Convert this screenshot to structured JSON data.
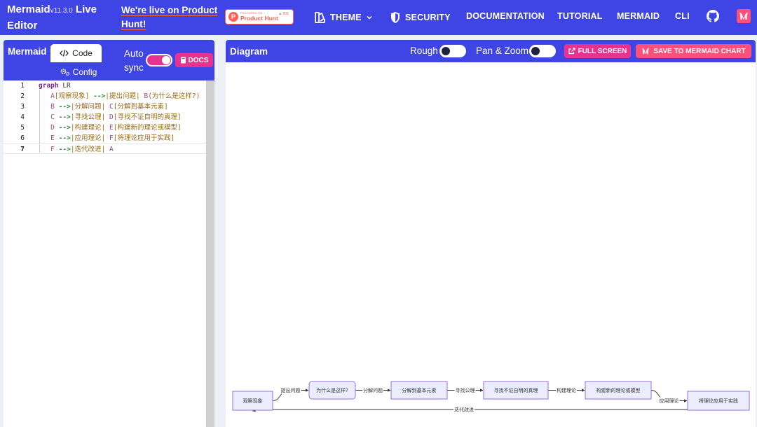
{
  "brand": {
    "name": "Mermaid",
    "version": "v11.3.0",
    "suffix": "Live Editor"
  },
  "promo": {
    "link_line1": "We're live on Product",
    "link_line2": "Hunt!",
    "badge_small": "FEATURED ON",
    "badge_text": "Product Hunt",
    "badge_count": "▲ 831"
  },
  "nav": {
    "theme": "THEME",
    "security": "SECURITY",
    "documentation": "DOCUMENTATION",
    "tutorial": "TUTORIAL",
    "mermaid": "MERMAID",
    "cli": "CLI"
  },
  "editor": {
    "title": "Mermaid",
    "tabs": {
      "code": "Code",
      "config": "Config"
    },
    "auto_sync_line1": "Auto",
    "auto_sync_line2": "sync",
    "auto_sync_on": true,
    "docs_label": "DOCS",
    "active_line": 7,
    "lines": [
      {
        "num": "1",
        "parts": [
          {
            "t": "kw",
            "v": "graph"
          },
          {
            "t": "pl",
            "v": " LR"
          }
        ]
      },
      {
        "num": "2",
        "parts": [
          {
            "t": "pl",
            "v": "   "
          },
          {
            "t": "nd",
            "v": "A"
          },
          {
            "t": "lb",
            "v": "[观察现象]"
          },
          {
            "t": "pl",
            "v": " "
          },
          {
            "t": "ar",
            "v": "-->"
          },
          {
            "t": "lb",
            "v": "|提出问题|"
          },
          {
            "t": "pl",
            "v": " "
          },
          {
            "t": "nd",
            "v": "B"
          },
          {
            "t": "lb",
            "v": "(为什么是这样?)"
          }
        ]
      },
      {
        "num": "3",
        "parts": [
          {
            "t": "pl",
            "v": "   "
          },
          {
            "t": "nd",
            "v": "B"
          },
          {
            "t": "pl",
            "v": " "
          },
          {
            "t": "ar",
            "v": "-->"
          },
          {
            "t": "lb",
            "v": "|分解问题|"
          },
          {
            "t": "pl",
            "v": " "
          },
          {
            "t": "nd",
            "v": "C"
          },
          {
            "t": "lb",
            "v": "[分解到基本元素]"
          }
        ]
      },
      {
        "num": "4",
        "parts": [
          {
            "t": "pl",
            "v": "   "
          },
          {
            "t": "nd",
            "v": "C"
          },
          {
            "t": "pl",
            "v": " "
          },
          {
            "t": "ar",
            "v": "-->"
          },
          {
            "t": "lb",
            "v": "|寻找公理|"
          },
          {
            "t": "pl",
            "v": " "
          },
          {
            "t": "nd",
            "v": "D"
          },
          {
            "t": "lb",
            "v": "[寻找不证自明的真理]"
          }
        ]
      },
      {
        "num": "5",
        "parts": [
          {
            "t": "pl",
            "v": "   "
          },
          {
            "t": "nd",
            "v": "D"
          },
          {
            "t": "pl",
            "v": " "
          },
          {
            "t": "ar",
            "v": "-->"
          },
          {
            "t": "lb",
            "v": "|构建理论|"
          },
          {
            "t": "pl",
            "v": " "
          },
          {
            "t": "nd",
            "v": "E"
          },
          {
            "t": "lb",
            "v": "[构建新的理论或模型]"
          }
        ]
      },
      {
        "num": "6",
        "parts": [
          {
            "t": "pl",
            "v": "   "
          },
          {
            "t": "nd",
            "v": "E"
          },
          {
            "t": "pl",
            "v": " "
          },
          {
            "t": "ar",
            "v": "-->"
          },
          {
            "t": "lb",
            "v": "|应用理论|"
          },
          {
            "t": "pl",
            "v": " "
          },
          {
            "t": "nd",
            "v": "F"
          },
          {
            "t": "lb",
            "v": "[将理论应用于实践]"
          }
        ]
      },
      {
        "num": "7",
        "parts": [
          {
            "t": "pl",
            "v": "   "
          },
          {
            "t": "nd",
            "v": "F"
          },
          {
            "t": "pl",
            "v": " "
          },
          {
            "t": "ar",
            "v": "-->"
          },
          {
            "t": "lb",
            "v": "|迭代改进|"
          },
          {
            "t": "pl",
            "v": " "
          },
          {
            "t": "nd",
            "v": "A"
          }
        ]
      }
    ]
  },
  "diagram": {
    "title": "Diagram",
    "rough_label": "Rough",
    "rough_on": false,
    "pan_zoom_label": "Pan & Zoom",
    "pan_zoom_on": false,
    "fullscreen_label": "FULL SCREEN",
    "save_label": "SAVE TO MERMAID CHART",
    "nodes": [
      {
        "id": "A",
        "label": "观察现象",
        "shape": "rect"
      },
      {
        "id": "B",
        "label": "为什么是这样?",
        "shape": "round"
      },
      {
        "id": "C",
        "label": "分解到基本元素",
        "shape": "rect"
      },
      {
        "id": "D",
        "label": "寻找不证自明的真理",
        "shape": "rect"
      },
      {
        "id": "E",
        "label": "构建新的理论或模型",
        "shape": "rect"
      },
      {
        "id": "F",
        "label": "将理论应用于实践",
        "shape": "rect"
      }
    ],
    "edges": [
      {
        "from": "A",
        "to": "B",
        "label": "提出问题"
      },
      {
        "from": "B",
        "to": "C",
        "label": "分解问题"
      },
      {
        "from": "C",
        "to": "D",
        "label": "寻找公理"
      },
      {
        "from": "D",
        "to": "E",
        "label": "构建理论"
      },
      {
        "from": "E",
        "to": "F",
        "label": "应用理论"
      },
      {
        "from": "F",
        "to": "A",
        "label": "迭代改进"
      }
    ]
  },
  "colors": {
    "nav_bg": "#3f45e5",
    "accent_pink": "#e6338f",
    "save_red": "#ff4f7b",
    "node_fill": "#ececff",
    "node_stroke": "#9370db"
  }
}
